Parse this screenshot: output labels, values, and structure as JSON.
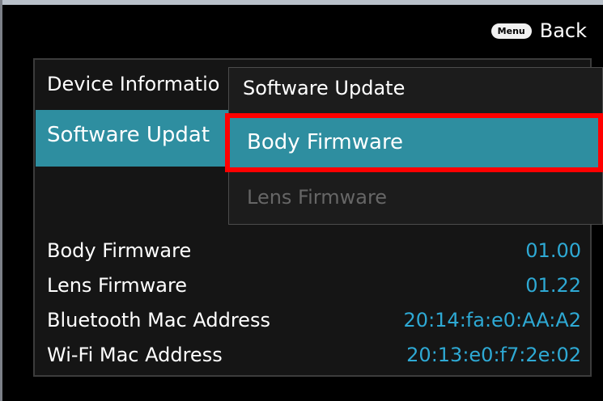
{
  "header": {
    "menu_badge": "Menu",
    "back_label": "Back"
  },
  "panel": {
    "title": "Device Informatio",
    "selected_item": "Software Updat"
  },
  "submenu": {
    "title": "Software Update",
    "items": [
      {
        "label": "Body Firmware",
        "state": "highlighted"
      },
      {
        "label": "Lens Firmware",
        "state": "disabled"
      }
    ]
  },
  "info": {
    "rows": [
      {
        "label": "Body Firmware",
        "value": "01.00"
      },
      {
        "label": "Lens Firmware",
        "value": "01.22"
      },
      {
        "label": "Bluetooth Mac Address",
        "value": "20:14:fa:e0:AA:A2"
      },
      {
        "label": "Wi-Fi Mac Address",
        "value": "20:13:e0:f7:2e:02"
      }
    ]
  },
  "colors": {
    "accent": "#2e8ea0",
    "value_text": "#2ea9d4",
    "annotation": "#ff0000"
  }
}
